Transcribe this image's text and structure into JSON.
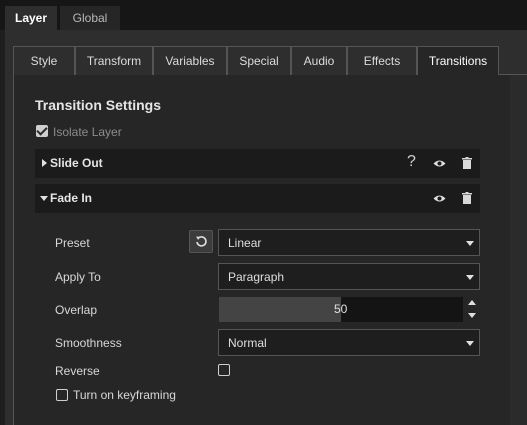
{
  "top_tabs": [
    {
      "label": "Layer",
      "active": true
    },
    {
      "label": "Global",
      "active": false
    }
  ],
  "sub_tabs": [
    {
      "label": "Style"
    },
    {
      "label": "Transform"
    },
    {
      "label": "Variables"
    },
    {
      "label": "Special"
    },
    {
      "label": "Audio"
    },
    {
      "label": "Effects"
    },
    {
      "label": "Transitions",
      "active": true
    }
  ],
  "transition_settings": {
    "title": "Transition Settings",
    "isolate_layer": {
      "label": "Isolate Layer",
      "checked": true
    }
  },
  "accordions": [
    {
      "title": "Slide Out",
      "expanded": false,
      "help_icon": "question-icon",
      "visibility_icon": "eye-icon",
      "delete_icon": "trash-icon"
    },
    {
      "title": "Fade In",
      "expanded": true,
      "visibility_icon": "eye-icon",
      "delete_icon": "trash-icon"
    }
  ],
  "fade_in": {
    "preset": {
      "label": "Preset",
      "value": "Linear",
      "reset_icon": "reset-icon"
    },
    "apply_to": {
      "label": "Apply To",
      "value": "Paragraph"
    },
    "overlap": {
      "label": "Overlap",
      "value": "50",
      "fraction": 0.5
    },
    "smoothness": {
      "label": "Smoothness",
      "value": "Normal"
    },
    "reverse": {
      "label": "Reverse",
      "checked": false
    },
    "keyframing": {
      "label": "Turn on keyframing",
      "checked": false
    }
  },
  "colors": {
    "background": "#1e1e1e",
    "panel": "#2e2e2e",
    "content": "#262626",
    "header_bar": "#1b1b1b",
    "accent_text": "#e6e6e6"
  }
}
